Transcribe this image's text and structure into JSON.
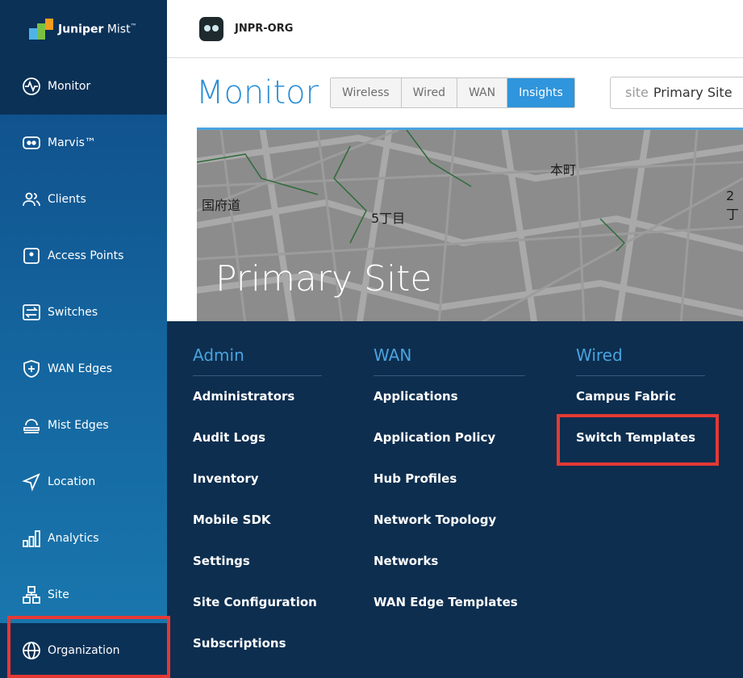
{
  "logo": {
    "brand": "Juniper",
    "product": "Mist",
    "tm": "™"
  },
  "org": {
    "name": "JNPR-ORG"
  },
  "sidebar": {
    "items": [
      {
        "label": "Monitor",
        "icon": "pulse-icon"
      },
      {
        "label": "Marvis™",
        "icon": "marvis-icon"
      },
      {
        "label": "Clients",
        "icon": "clients-icon"
      },
      {
        "label": "Access Points",
        "icon": "access-point-icon"
      },
      {
        "label": "Switches",
        "icon": "switch-icon"
      },
      {
        "label": "WAN Edges",
        "icon": "wan-edge-icon"
      },
      {
        "label": "Mist Edges",
        "icon": "mist-edge-icon"
      },
      {
        "label": "Location",
        "icon": "location-icon"
      },
      {
        "label": "Analytics",
        "icon": "analytics-icon"
      },
      {
        "label": "Site",
        "icon": "site-icon"
      },
      {
        "label": "Organization",
        "icon": "globe-icon"
      }
    ]
  },
  "page": {
    "title": "Monitor"
  },
  "tabs": [
    {
      "label": "Wireless"
    },
    {
      "label": "Wired"
    },
    {
      "label": "WAN"
    },
    {
      "label": "Insights"
    }
  ],
  "site_select": {
    "key": "site",
    "value": "Primary Site"
  },
  "map": {
    "site_title": "Primary Site",
    "labels": [
      "本町",
      "国府道",
      "5丁目",
      "2丁"
    ]
  },
  "menu": {
    "admin": {
      "heading": "Admin",
      "items": [
        "Administrators",
        "Audit Logs",
        "Inventory",
        "Mobile SDK",
        "Settings",
        "Site Configuration",
        "Subscriptions"
      ]
    },
    "wan": {
      "heading": "WAN",
      "items": [
        "Applications",
        "Application Policy",
        "Hub Profiles",
        "Network Topology",
        "Networks",
        "WAN Edge Templates"
      ]
    },
    "wired": {
      "heading": "Wired",
      "items": [
        "Campus Fabric",
        "Switch Templates"
      ]
    }
  },
  "colors": {
    "accent": "#2b8fd6",
    "active_tab": "#2f95dc",
    "menu_bg": "#0d2e4f",
    "highlight": "#e53935"
  }
}
